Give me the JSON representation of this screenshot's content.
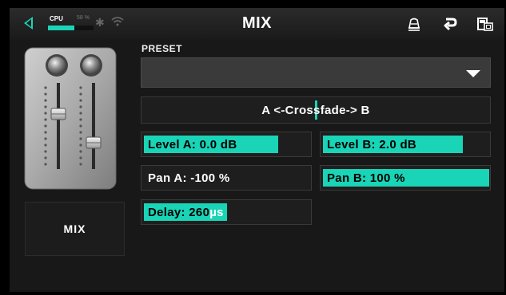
{
  "status": {
    "cpu_label": "CPU",
    "cpu_percent_text": "58 %",
    "cpu_load": 0.58,
    "bluetooth_icon": "bluetooth-icon",
    "wifi_icon": "wifi-icon"
  },
  "header": {
    "title": "MIX",
    "back_icon": "back-arrow-icon",
    "icons": [
      "tuner-icon",
      "return-icon",
      "preset-icon"
    ]
  },
  "device": {
    "image": "mixer-device-image",
    "name": "MIX"
  },
  "preset": {
    "label": "PRESET",
    "value": ""
  },
  "controls": {
    "crossfade": {
      "label": "A <-Crossfade-> B",
      "position": 0.5
    },
    "level_a": {
      "text": "Level A: 0.0 dB",
      "fill": 0.81
    },
    "level_b": {
      "text": "Level B: 2.0 dB",
      "fill": 0.84
    },
    "pan_a": {
      "text": "Pan A: -100 %",
      "fill": 0.0
    },
    "pan_b": {
      "text": "Pan B: 100 %",
      "fill": 1.0
    },
    "delay": {
      "value": "Delay: 260",
      "unit": "µs",
      "fill": 0.5
    }
  },
  "colors": {
    "accent": "#19d4b6",
    "background": "#000000",
    "panel": "#181818"
  }
}
